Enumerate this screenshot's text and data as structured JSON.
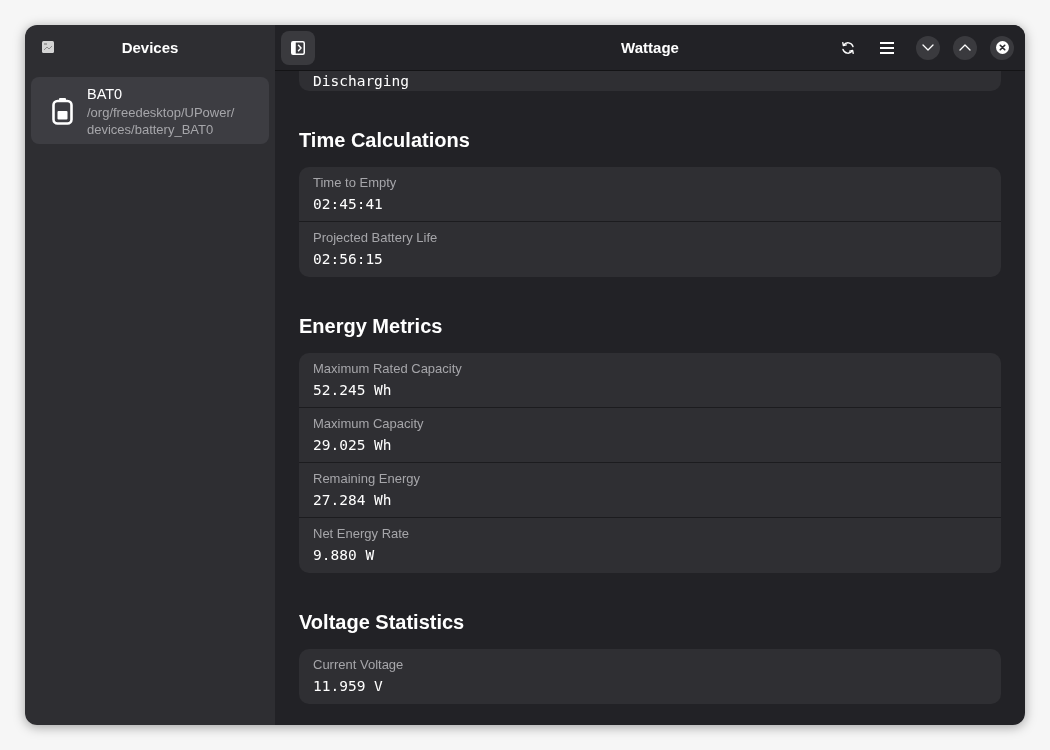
{
  "sidebar": {
    "title": "Devices",
    "devices": [
      {
        "name": "BAT0",
        "path": "/org/freedesktop/UPower/devices/battery_BAT0",
        "selected": true
      }
    ]
  },
  "header": {
    "title": "Wattage"
  },
  "sections": [
    {
      "rows": [
        {
          "value": "Discharging"
        }
      ]
    },
    {
      "title": "Time Calculations",
      "rows": [
        {
          "label": "Time to Empty",
          "value": "02:45:41"
        },
        {
          "label": "Projected Battery Life",
          "value": "02:56:15"
        }
      ]
    },
    {
      "title": "Energy Metrics",
      "rows": [
        {
          "label": "Maximum Rated Capacity",
          "value": "52.245 Wh"
        },
        {
          "label": "Maximum Capacity",
          "value": "29.025 Wh"
        },
        {
          "label": "Remaining Energy",
          "value": "27.284 Wh"
        },
        {
          "label": "Net Energy Rate",
          "value": "9.880 W"
        }
      ]
    },
    {
      "title": "Voltage Statistics",
      "rows": [
        {
          "label": "Current Voltage",
          "value": "11.959 V"
        }
      ]
    }
  ]
}
